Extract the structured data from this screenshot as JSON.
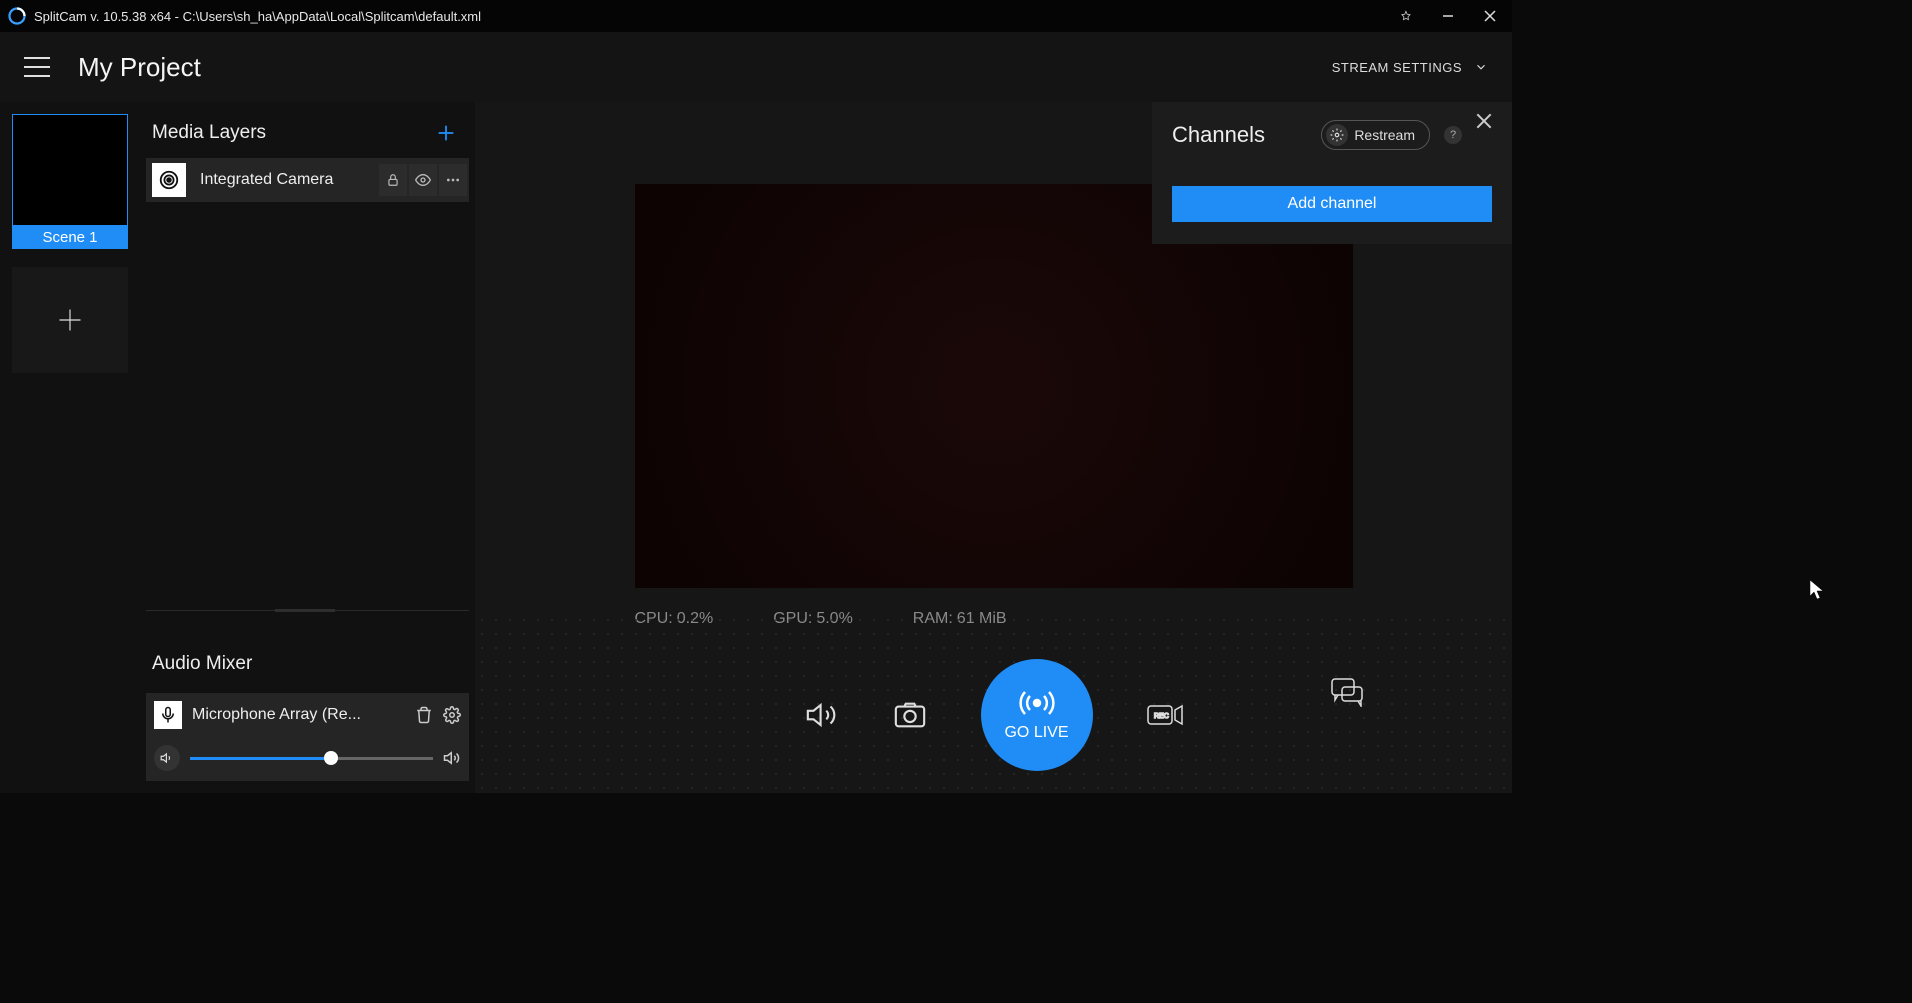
{
  "titlebar": {
    "text": "SplitCam v. 10.5.38 x64 - C:\\Users\\sh_ha\\AppData\\Local\\Splitcam\\default.xml"
  },
  "header": {
    "project_title": "My Project",
    "stream_settings": "STREAM SETTINGS"
  },
  "sidebar": {
    "scene1_label": "Scene 1",
    "media_layers_title": "Media Layers",
    "layer1_name": "Integrated Camera",
    "audio_mixer_title": "Audio Mixer",
    "audio1_name": "Microphone Array (Re..."
  },
  "stats": {
    "cpu_label": "CPU:",
    "cpu_value": "0.2%",
    "gpu_label": "GPU:",
    "gpu_value": "5.0%",
    "ram_label": "RAM:",
    "ram_value": "61 MiB"
  },
  "controls": {
    "go_live": "GO LIVE"
  },
  "channels": {
    "title": "Channels",
    "restream": "Restream",
    "help": "?",
    "add_channel": "Add channel"
  }
}
